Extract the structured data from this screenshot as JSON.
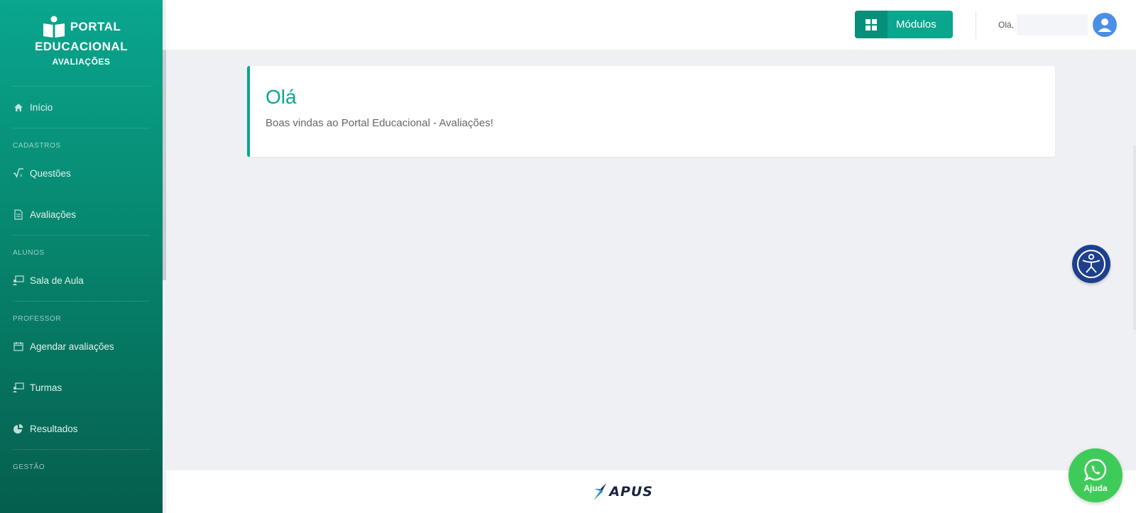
{
  "brand": {
    "line1": "PORTAL",
    "line2": "EDUCACIONAL",
    "line3": "AVALIAÇÕES"
  },
  "sidebar": {
    "home": "Início",
    "sections": {
      "cadastros": "CADASTROS",
      "alunos": "ALUNOS",
      "professor": "PROFESSOR",
      "gestao": "GESTÃO"
    },
    "items": {
      "questoes": "Questões",
      "avaliacoes": "Avaliações",
      "sala_de_aula": "Sala de Aula",
      "agendar": "Agendar avaliações",
      "turmas": "Turmas",
      "resultados": "Resultados"
    }
  },
  "topbar": {
    "modules_label": "Módulos",
    "greeting": "Olá,"
  },
  "card": {
    "title": "Olá",
    "text": "Boas vindas ao Portal Educacional - Avaliações!"
  },
  "footer": {
    "logo_text": "APUS"
  },
  "floating": {
    "help_label": "Ajuda"
  },
  "colors": {
    "primary": "#0aa68e",
    "accessibility": "#1d3f8c",
    "whatsapp": "#3fcb59",
    "avatar": "#4b8ee6"
  }
}
